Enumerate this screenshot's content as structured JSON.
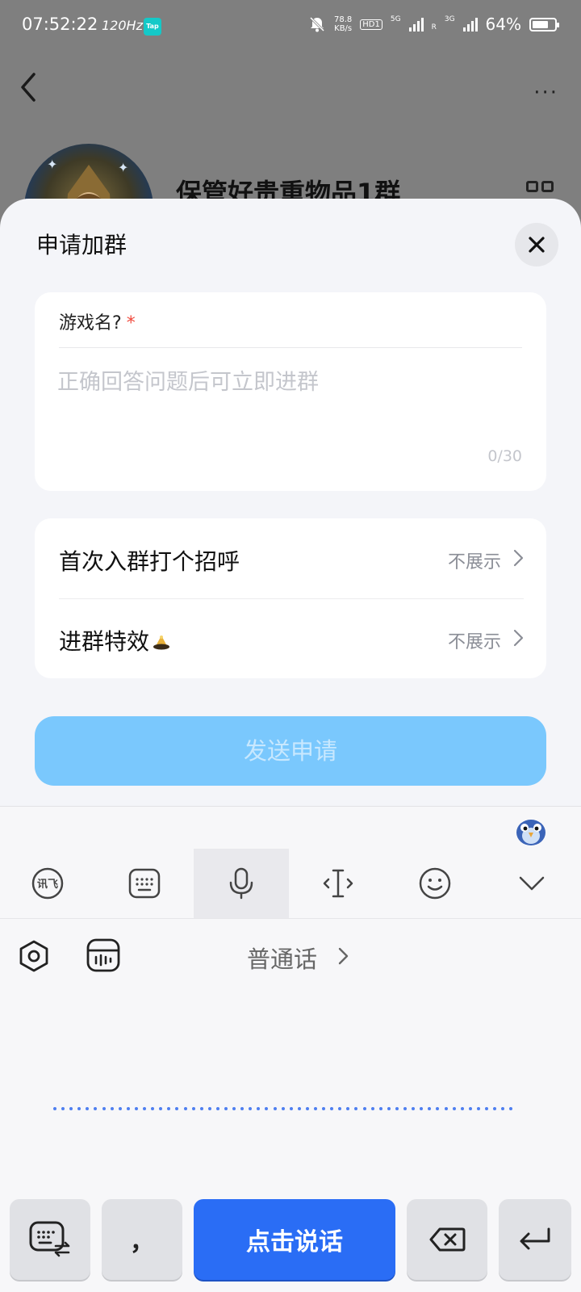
{
  "status_bar": {
    "time": "07:52:22",
    "refresh": "120Hz",
    "tap_badge": "Tap",
    "speed_value": "78.8",
    "speed_unit": "KB/s",
    "hd": "HD1",
    "net1": "5G",
    "net2": "R",
    "net3": "3G",
    "battery": "64%"
  },
  "background_page": {
    "more_label": "···",
    "group_title": "保管好贵重物品1群"
  },
  "dialog": {
    "title": "申请加群",
    "question": {
      "label": "游戏名?",
      "required_mark": "*",
      "placeholder": "正确回答问题后可立即进群",
      "value": "",
      "counter": "0/30"
    },
    "options": [
      {
        "label": "首次入群打个招呼",
        "value": "不展示"
      },
      {
        "label": "进群特效",
        "value": "不展示"
      }
    ],
    "send_button": "发送申请"
  },
  "keyboard": {
    "toolbar": [
      "iflytek-logo-icon",
      "keyboard-icon",
      "microphone-icon",
      "text-cursor-icon",
      "emoji-icon",
      "collapse-icon"
    ],
    "active_tool": "microphone-icon",
    "language": "普通话",
    "comma_key": "，",
    "talk_key": "点击说话"
  },
  "colors": {
    "accent": "#2a6df5",
    "send_disabled": "#7ac8fd",
    "required": "#f04a3d"
  }
}
